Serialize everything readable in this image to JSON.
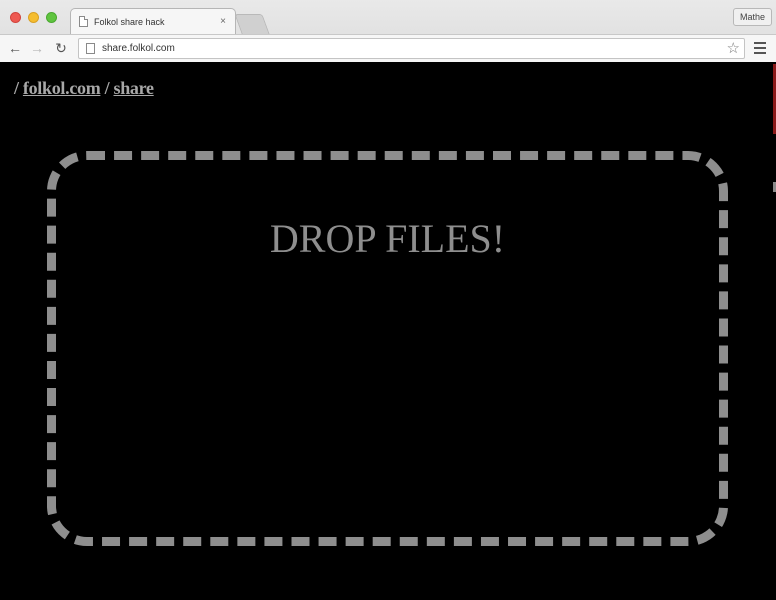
{
  "browser": {
    "tab_title": "Folkol share hack",
    "tab_close": "×",
    "profile_label": "Mathe",
    "url": "share.folkol.com",
    "back_glyph": "←",
    "forward_glyph": "→",
    "reload_glyph": "↻",
    "star_glyph": "☆",
    "icons": {
      "tab": "document-icon",
      "back": "arrow-left-icon",
      "forward": "arrow-right-icon",
      "reload": "reload-icon",
      "page": "page-icon",
      "bookmark": "star-icon",
      "menu": "hamburger-menu-icon"
    }
  },
  "page": {
    "breadcrumb": {
      "sep1": "/ ",
      "site_link": "folkol.com",
      "sep2": " / ",
      "page_link": "share"
    },
    "dropzone": {
      "label": "DROP FILES!"
    }
  },
  "colors": {
    "page_background": "#000000",
    "dropzone_text_and_border": "#8e8e8e",
    "breadcrumb_text": "#a8a8a8"
  }
}
